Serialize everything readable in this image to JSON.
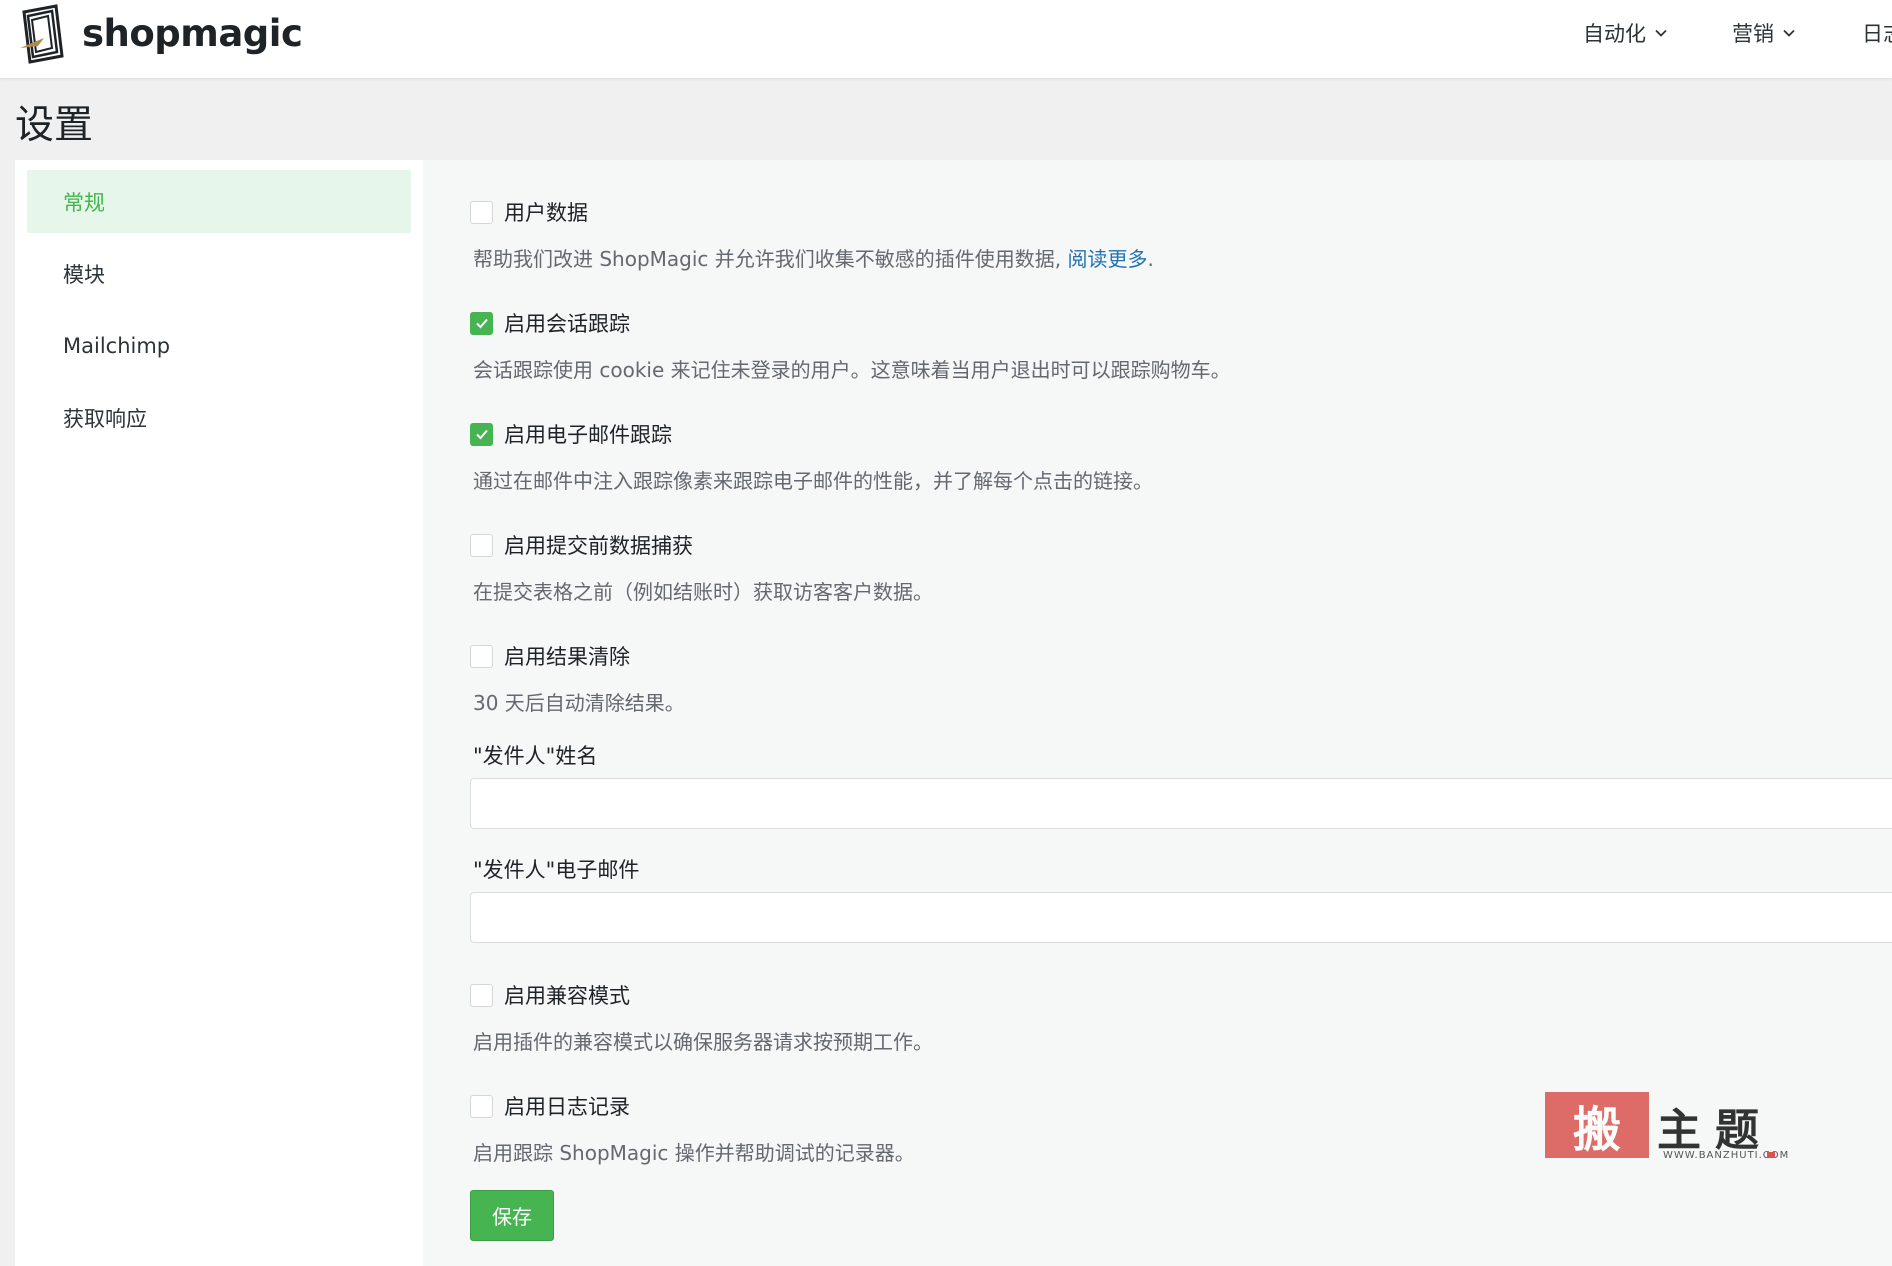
{
  "brand": {
    "name": "shopmagic",
    "accent": "#46b450",
    "link_color": "#2271b1"
  },
  "nav": {
    "items": [
      {
        "label": "自动化"
      },
      {
        "label": "营销"
      },
      {
        "label": "日志"
      }
    ]
  },
  "page": {
    "title": "设置"
  },
  "sidebar": {
    "items": [
      {
        "label": "常规",
        "active": true
      },
      {
        "label": "模块"
      },
      {
        "label": "Mailchimp"
      },
      {
        "label": "获取响应"
      }
    ]
  },
  "settings": {
    "user_data": {
      "label": "用户数据",
      "checked": false,
      "desc": "帮助我们改进 ShopMagic 并允许我们收集不敏感的插件使用数据,",
      "link": "阅读更多",
      "link_suffix": "."
    },
    "session_tracking": {
      "label": "启用会话跟踪",
      "checked": true,
      "desc": "会话跟踪使用 cookie 来记住未登录的用户。这意味着当用户退出时可以跟踪购物车。"
    },
    "email_tracking": {
      "label": "启用电子邮件跟踪",
      "checked": true,
      "desc": "通过在邮件中注入跟踪像素来跟踪电子邮件的性能，并了解每个点击的链接。"
    },
    "pre_submit": {
      "label": "启用提交前数据捕获",
      "checked": false,
      "desc": "在提交表格之前（例如结账时）获取访客客户数据。"
    },
    "cleanup": {
      "label": "启用结果清除",
      "checked": false,
      "desc": "30 天后自动清除结果。"
    },
    "from_name": {
      "label": "\"发件人\"姓名",
      "value": ""
    },
    "from_email": {
      "label": "\"发件人\"电子邮件",
      "value": ""
    },
    "compat": {
      "label": "启用兼容模式",
      "checked": false,
      "desc": "启用插件的兼容模式以确保服务器请求按预期工作。"
    },
    "logging": {
      "label": "启用日志记录",
      "checked": false,
      "desc": "启用跟踪 ShopMagic 操作并帮助调试的记录器。"
    }
  },
  "actions": {
    "save_label": "保存"
  },
  "watermark": {
    "glyph": "搬",
    "text": "主题",
    "sub": "WWW.BANZHUTI.COM"
  }
}
